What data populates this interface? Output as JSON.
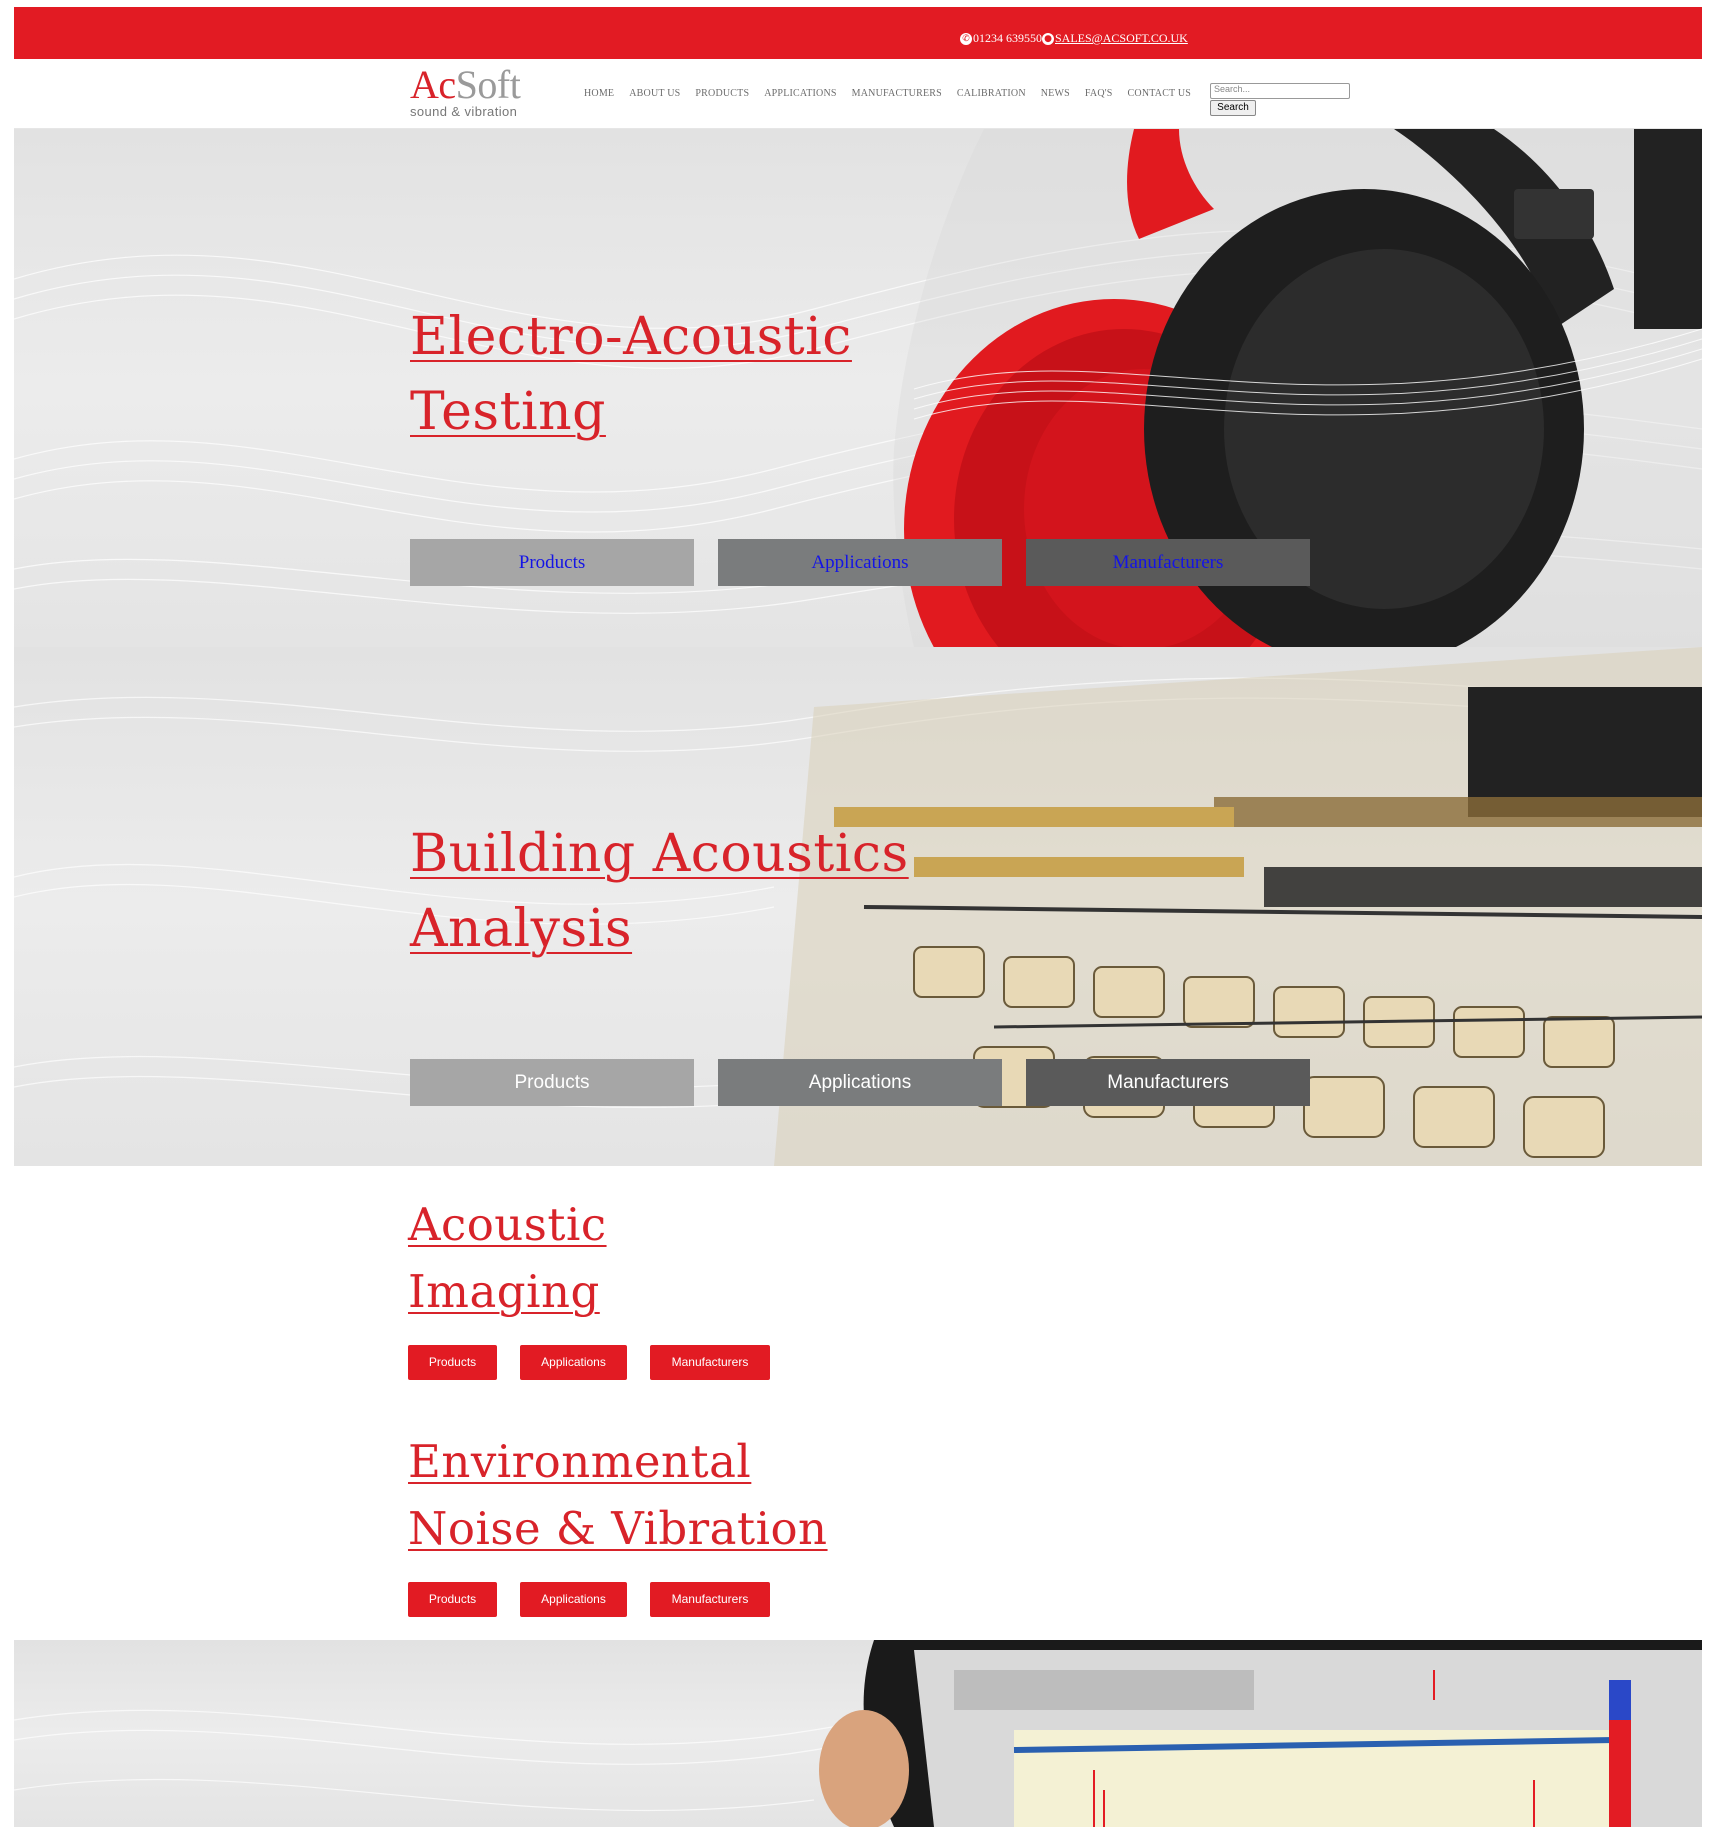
{
  "topbar": {
    "phone": "01234 639550",
    "email": "SALES@ACSOFT.CO.UK"
  },
  "header": {
    "logo_ac": "Ac",
    "logo_soft": "Soft",
    "logo_tagline": "sound & vibration",
    "nav": [
      "HOME",
      "ABOUT US",
      "PRODUCTS",
      "APPLICATIONS",
      "MANUFACTURERS",
      "CALIBRATION",
      "NEWS",
      "FAQ'S",
      "CONTACT US"
    ],
    "search_placeholder": "Search...",
    "search_button": "Search"
  },
  "sections": [
    {
      "title_line1": "Electro-Acoustic",
      "title_line2": "Testing",
      "buttons": [
        "Products",
        "Applications",
        "Manufacturers"
      ]
    },
    {
      "title_line1": "Building Acoustics",
      "title_line2": "Analysis",
      "buttons": [
        "Products",
        "Applications",
        "Manufacturers"
      ]
    },
    {
      "title_line1": "Acoustic",
      "title_line2": "Imaging",
      "buttons": [
        "Products",
        "Applications",
        "Manufacturers"
      ]
    },
    {
      "title_line1": "Environmental",
      "title_line2": "Noise & Vibration",
      "buttons": [
        "Products",
        "Applications",
        "Manufacturers"
      ]
    }
  ],
  "colors": {
    "brand_red": "#e21b23",
    "title_red": "#d8232a",
    "button_grey_light": "#a6a6a6",
    "button_grey_mid": "#7a7c7d",
    "button_grey_dark": "#5a5a5a"
  },
  "icons": {
    "phone": "phone-icon",
    "email": "globe-icon"
  }
}
